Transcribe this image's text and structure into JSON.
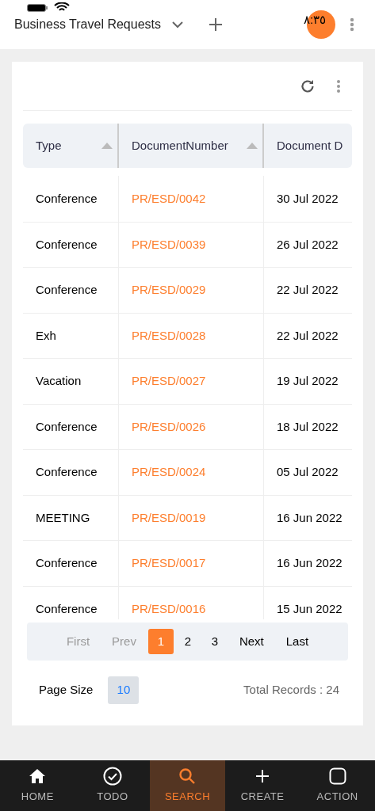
{
  "status_bar": {
    "time": "٨:٣٥"
  },
  "header": {
    "title": "Business Travel Requests"
  },
  "table": {
    "columns": [
      {
        "label": "Type",
        "sortable": true
      },
      {
        "label": "DocumentNumber",
        "sortable": true
      },
      {
        "label": "Document D"
      }
    ],
    "rows": [
      {
        "type": "Conference",
        "document_number": "PR/ESD/0042",
        "date": "30 Jul 2022"
      },
      {
        "type": "Conference",
        "document_number": "PR/ESD/0039",
        "date": "26 Jul 2022"
      },
      {
        "type": "Conference",
        "document_number": "PR/ESD/0029",
        "date": "22 Jul 2022"
      },
      {
        "type": "Exh",
        "document_number": "PR/ESD/0028",
        "date": "22 Jul 2022"
      },
      {
        "type": "Vacation",
        "document_number": "PR/ESD/0027",
        "date": "19 Jul 2022"
      },
      {
        "type": "Conference",
        "document_number": "PR/ESD/0026",
        "date": "18 Jul 2022"
      },
      {
        "type": "Conference",
        "document_number": "PR/ESD/0024",
        "date": "05 Jul 2022"
      },
      {
        "type": "MEETING",
        "document_number": "PR/ESD/0019",
        "date": "16 Jun 2022"
      },
      {
        "type": "Conference",
        "document_number": "PR/ESD/0017",
        "date": "16 Jun 2022"
      },
      {
        "type": "Conference",
        "document_number": "PR/ESD/0016",
        "date": "15 Jun 2022"
      }
    ]
  },
  "pagination": {
    "items": [
      {
        "label": "First",
        "kind": "nav",
        "disabled": true,
        "selected": false
      },
      {
        "label": "Prev",
        "kind": "nav",
        "disabled": true,
        "selected": false
      },
      {
        "label": "1",
        "kind": "page",
        "selected": true
      },
      {
        "label": "2",
        "kind": "page",
        "selected": false
      },
      {
        "label": "3",
        "kind": "page",
        "selected": false
      },
      {
        "label": "Next",
        "kind": "nav",
        "disabled": false,
        "selected": false
      },
      {
        "label": "Last",
        "kind": "nav",
        "disabled": false,
        "selected": false
      }
    ],
    "page_size_label": "Page Size",
    "page_size": "10",
    "total": "Total Records : 24"
  },
  "bottom_nav": [
    {
      "label": "HOME",
      "selected": false
    },
    {
      "label": "TODO",
      "selected": false
    },
    {
      "label": "SEARCH",
      "selected": true
    },
    {
      "label": "CREATE",
      "selected": false
    },
    {
      "label": "ACTION",
      "selected": false
    }
  ]
}
